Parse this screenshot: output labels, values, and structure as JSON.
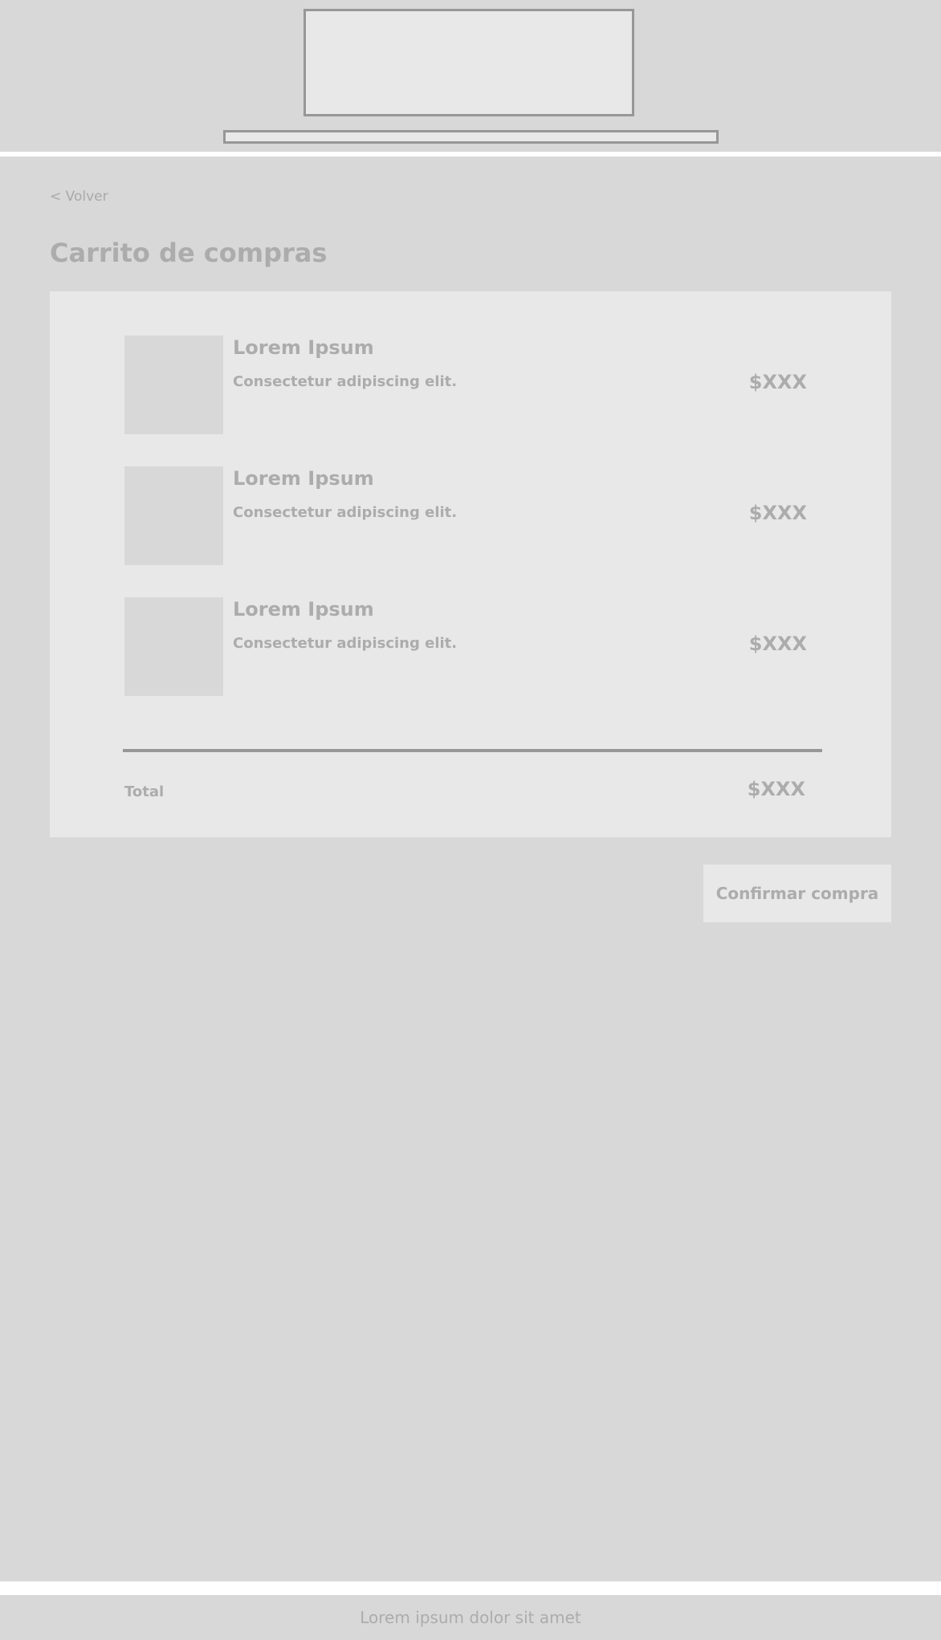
{
  "header": {},
  "back_link": {
    "label": "< Volver"
  },
  "page_title": "Carrito de compras",
  "cart": {
    "items": [
      {
        "name": "Lorem Ipsum",
        "description": "Consectetur adipiscing elit.",
        "price": "$XXX"
      },
      {
        "name": "Lorem Ipsum",
        "description": "Consectetur adipiscing elit.",
        "price": "$XXX"
      },
      {
        "name": "Lorem Ipsum",
        "description": "Consectetur adipiscing elit.",
        "price": "$XXX"
      }
    ],
    "total_label": "Total",
    "total_value": "$XXX"
  },
  "confirm_button": {
    "label": "Confirmar compra"
  },
  "footer": {
    "text": "Lorem ipsum dolor sit amet"
  },
  "colors": {
    "background": "#d8d8d8",
    "panel": "#e8e8e8",
    "text": "#acacac",
    "border": "#979797",
    "separator": "#ffffff"
  }
}
